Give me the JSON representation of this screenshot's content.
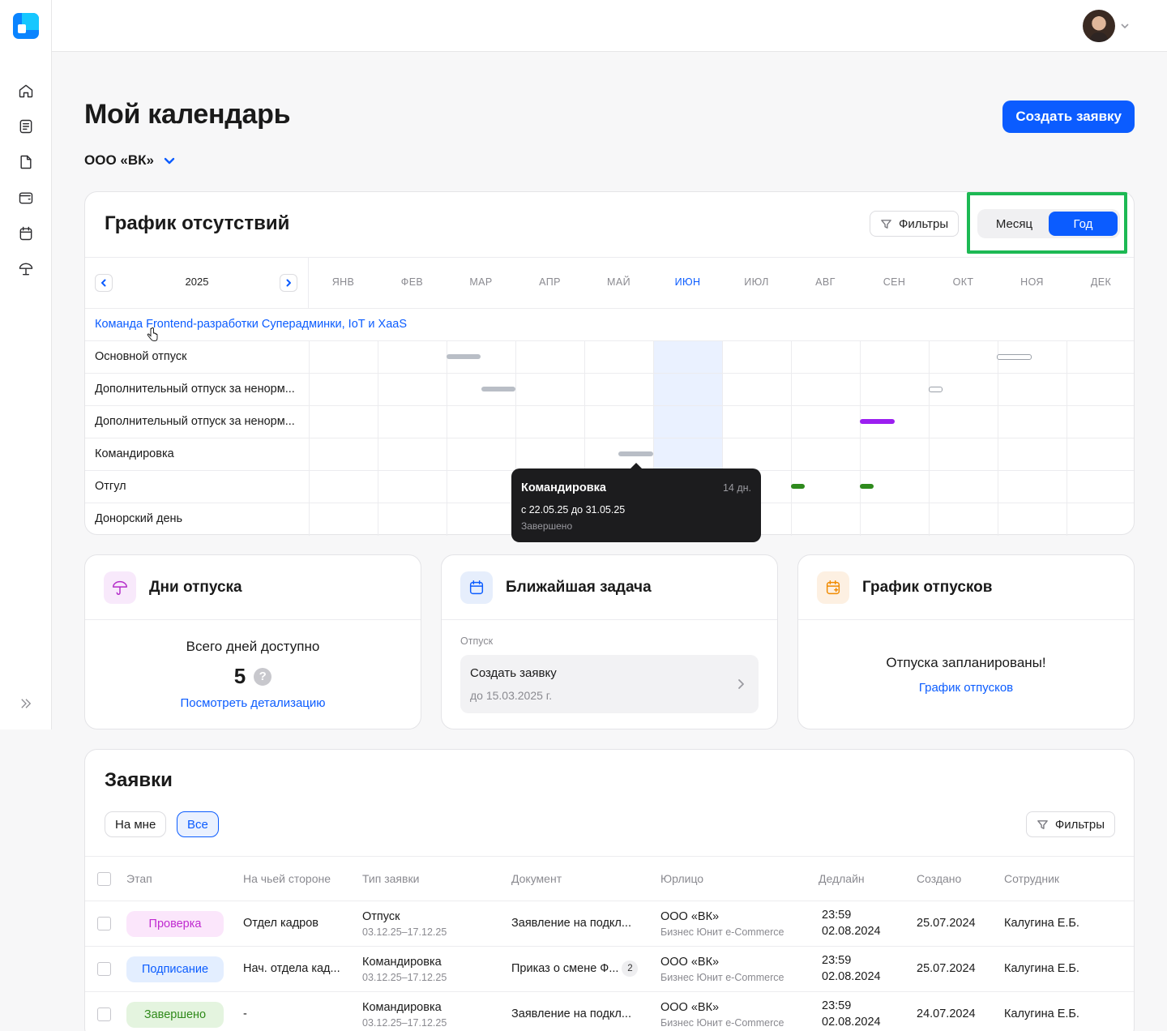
{
  "app": {
    "title": "Мой календарь",
    "org": "ООО «ВК»",
    "create_button": "Создать заявку"
  },
  "sidebar": {
    "items": [
      {
        "icon": "home-icon"
      },
      {
        "icon": "list-icon"
      },
      {
        "icon": "document-icon"
      },
      {
        "icon": "wallet-icon"
      },
      {
        "icon": "calendar-icon"
      },
      {
        "icon": "umbrella-icon"
      }
    ]
  },
  "absence": {
    "title": "График отсутствий",
    "filters_label": "Фильтры",
    "view_toggle": {
      "month": "Месяц",
      "year": "Год",
      "selected": "year"
    },
    "year": "2025",
    "months": [
      "ЯНВ",
      "ФЕВ",
      "МАР",
      "АПР",
      "МАЙ",
      "ИЮН",
      "ИЮЛ",
      "АВГ",
      "СЕН",
      "ОКТ",
      "НОЯ",
      "ДЕК"
    ],
    "current_month": "ИЮН",
    "team": "Команда Frontend-разработки Суперадминки, IoT и XaaS",
    "rows": [
      {
        "label": "Основной отпуск"
      },
      {
        "label": "Дополнительный отпуск за ненорм..."
      },
      {
        "label": "Дополнительный отпуск за ненорм..."
      },
      {
        "label": "Командировка"
      },
      {
        "label": "Отгул"
      },
      {
        "label": "Донорский день"
      }
    ],
    "tooltip": {
      "title": "Командировка",
      "days": "14 дн.",
      "range": "с 22.05.25 до 31.05.25",
      "status": "Завершено"
    }
  },
  "cards": {
    "vacation_days": {
      "title": "Дни отпуска",
      "total_label": "Всего дней доступно",
      "count": "5",
      "help": "?",
      "link": "Посмотреть детализацию"
    },
    "next_task": {
      "title": "Ближайшая задача",
      "category": "Отпуск",
      "task_title": "Создать заявку",
      "task_due": "до 15.03.2025 г."
    },
    "vacation_schedule": {
      "title": "График отпусков",
      "text": "Отпуска запланированы!",
      "link": "График отпусков"
    }
  },
  "requests": {
    "title": "Заявки",
    "chips": {
      "mine": "На мне",
      "all": "Все",
      "selected": "all"
    },
    "filters_label": "Фильтры",
    "columns": [
      "Этап",
      "На чьей стороне",
      "Тип заявки",
      "Документ",
      "Юрлицо",
      "Дедлайн",
      "Создано",
      "Сотрудник"
    ],
    "rows": [
      {
        "stage": "Проверка",
        "side": "Отдел кадров",
        "type": "Отпуск",
        "type_dates": "03.12.25–17.12.25",
        "document": "Заявление на подкл...",
        "doc_count": "",
        "entity": "ООО «ВК»",
        "entity_sub": "Бизнес Юнит e-Commerce",
        "deadline_time": "23:59",
        "deadline_date": "02.08.2024",
        "created": "25.07.2024",
        "employee": "Калугина Е.Б."
      },
      {
        "stage": "Подписание",
        "side": "Нач. отдела кад...",
        "type": "Командировка",
        "type_dates": "03.12.25–17.12.25",
        "document": "Приказ о смене Ф...",
        "doc_count": "2",
        "entity": "ООО «ВК»",
        "entity_sub": "Бизнес Юнит e-Commerce",
        "deadline_time": "23:59",
        "deadline_date": "02.08.2024",
        "created": "25.07.2024",
        "employee": "Калугина Е.Б."
      },
      {
        "stage": "Завершено",
        "side": "-",
        "type": "Командировка",
        "type_dates": "03.12.25–17.12.25",
        "document": "Заявление на подкл...",
        "doc_count": "",
        "entity": "ООО «ВК»",
        "entity_sub": "Бизнес Юнит e-Commerce",
        "deadline_time": "23:59",
        "deadline_date": "02.08.2024",
        "created": "24.07.2024",
        "employee": "Калугина Е.Б."
      }
    ]
  },
  "colors": {
    "accent": "#0b5cff",
    "highlight": "#1db954",
    "bar_gray": "#b9bec6",
    "bar_purple": "#9b1ff0",
    "bar_green": "#2e8a1d"
  }
}
